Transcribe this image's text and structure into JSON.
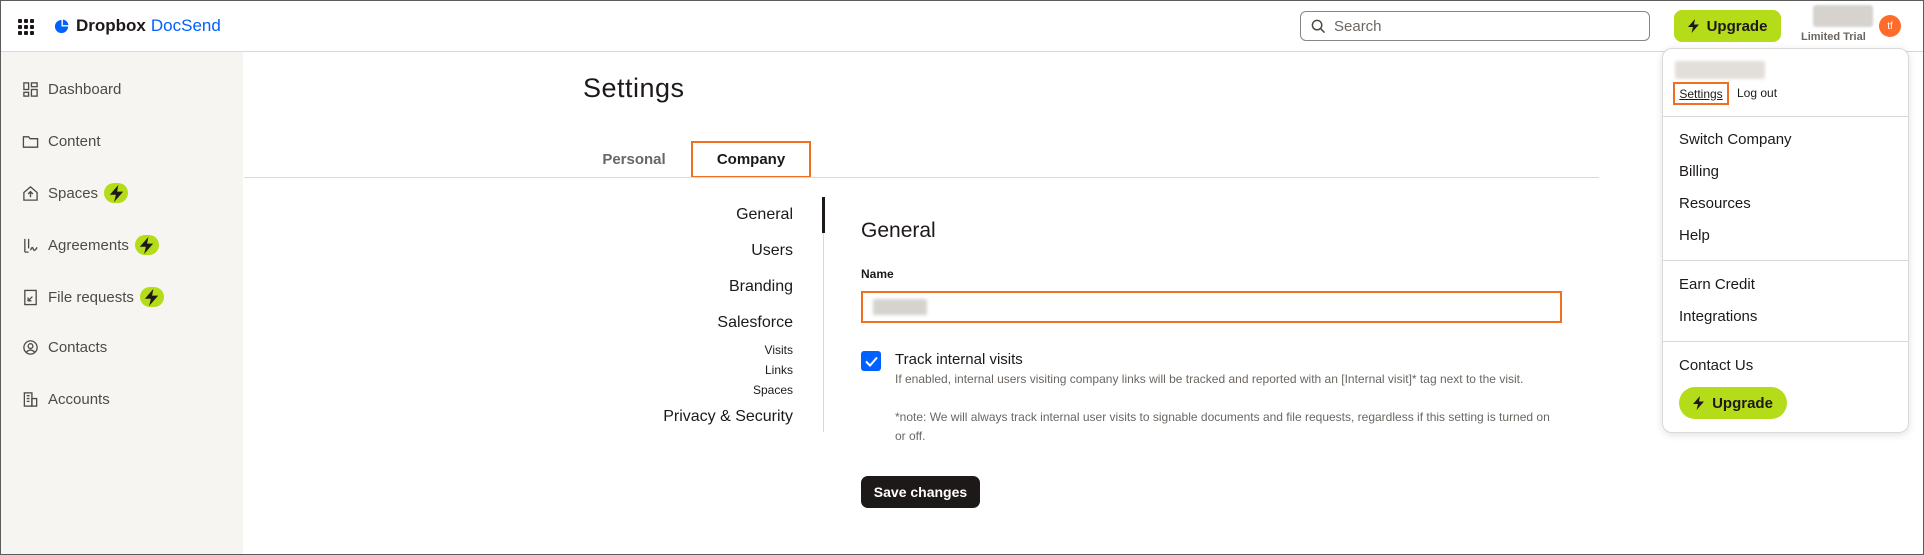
{
  "app": {
    "brand": "Dropbox",
    "product": "DocSend"
  },
  "topbar": {
    "search_placeholder": "Search",
    "upgrade_label": "Upgrade",
    "avatar_initials": "tf",
    "trial_label": "Limited Trial"
  },
  "sidebar": {
    "items": [
      {
        "label": "Dashboard",
        "icon": "dashboard-icon",
        "badge": false
      },
      {
        "label": "Content",
        "icon": "folder-icon",
        "badge": false
      },
      {
        "label": "Spaces",
        "icon": "spaces-icon",
        "badge": true
      },
      {
        "label": "Agreements",
        "icon": "agreements-icon",
        "badge": true
      },
      {
        "label": "File requests",
        "icon": "file-request-icon",
        "badge": true
      },
      {
        "label": "Contacts",
        "icon": "contacts-icon",
        "badge": false
      },
      {
        "label": "Accounts",
        "icon": "accounts-icon",
        "badge": false
      }
    ]
  },
  "page": {
    "title": "Settings",
    "tabs": [
      {
        "label": "Personal",
        "active": false
      },
      {
        "label": "Company",
        "active": true
      }
    ]
  },
  "subnav": {
    "items": [
      {
        "label": "General",
        "size": "big",
        "active": true
      },
      {
        "label": "Users",
        "size": "big",
        "active": false
      },
      {
        "label": "Branding",
        "size": "big",
        "active": false
      },
      {
        "label": "Salesforce",
        "size": "big",
        "active": false
      },
      {
        "label": "Visits",
        "size": "small",
        "active": false
      },
      {
        "label": "Links",
        "size": "small",
        "active": false
      },
      {
        "label": "Spaces",
        "size": "small",
        "active": false
      },
      {
        "label": "Privacy & Security",
        "size": "big",
        "active": false
      }
    ]
  },
  "general": {
    "section_title": "General",
    "name_label": "Name",
    "name_value": "",
    "track_checked": true,
    "track_label": "Track internal visits",
    "track_desc_1": "If enabled, internal users visiting company links will be tracked and reported with an [Internal visit]* tag next to the visit.",
    "track_desc_2": "*note: We will always track internal user visits to signable documents and file requests, regardless if this setting is turned on or off.",
    "save_label": "Save changes"
  },
  "dropdown": {
    "settings_label": "Settings",
    "logout_label": "Log out",
    "group1": [
      "Switch Company",
      "Billing",
      "Resources",
      "Help"
    ],
    "group2": [
      "Earn Credit",
      "Integrations"
    ],
    "group3": [
      "Contact Us"
    ],
    "upgrade_label": "Upgrade"
  },
  "colors": {
    "accent_upgrade": "#b4dc19",
    "highlight_outline": "#f26e23",
    "brand_blue": "#0061fe",
    "checkbox": "#0061fe",
    "save_button": "#1e1919",
    "avatar": "#ff6b2c"
  }
}
